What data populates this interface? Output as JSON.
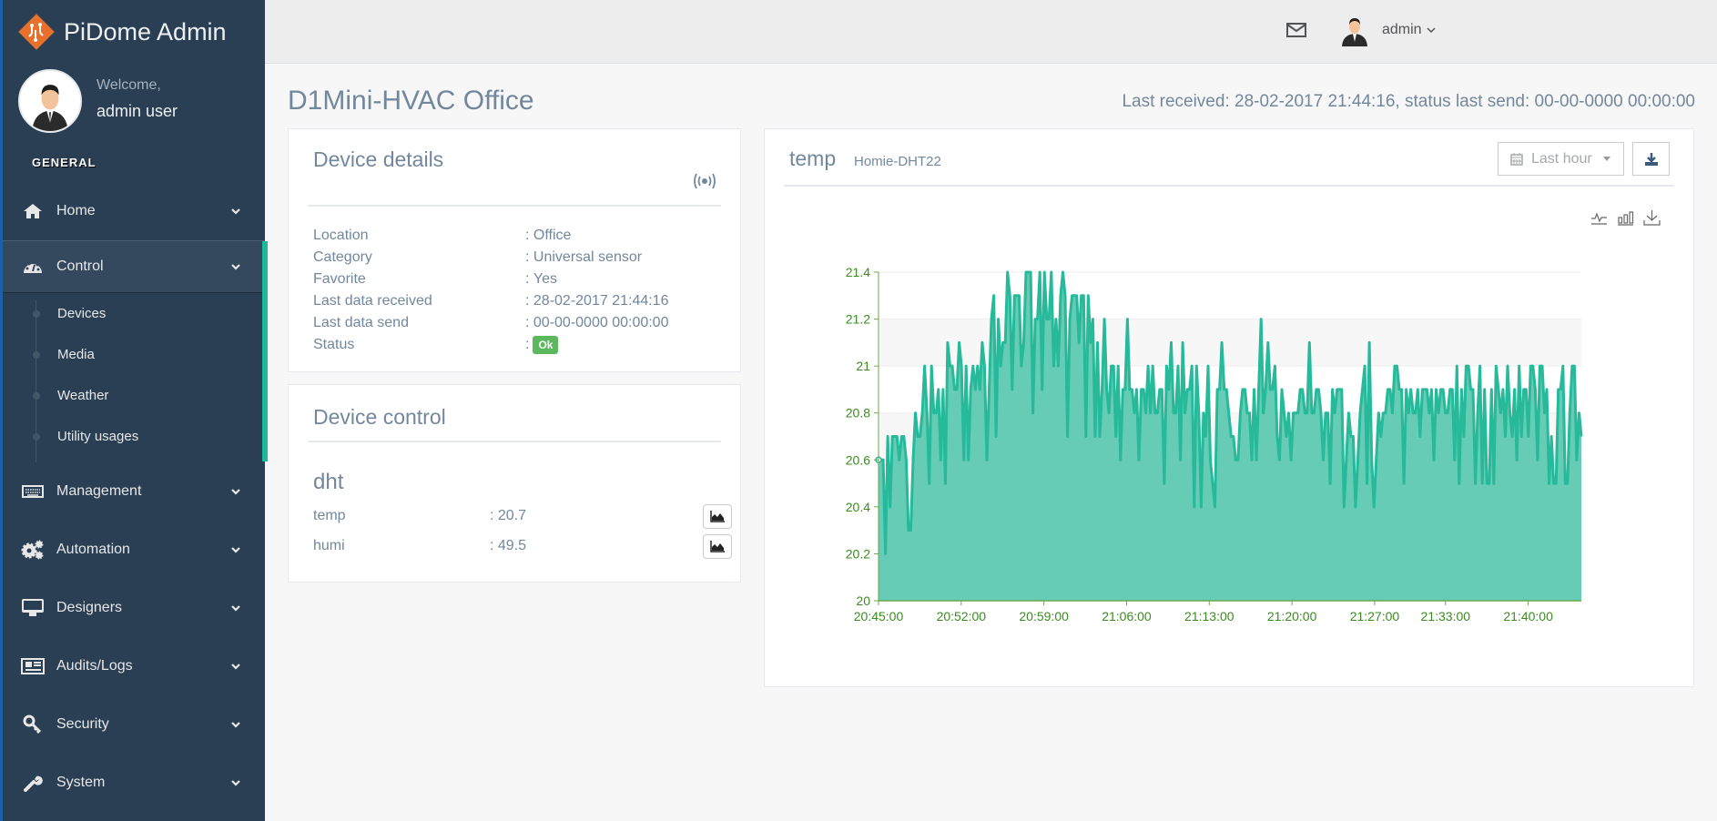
{
  "app": {
    "title": "PiDome Admin",
    "welcome": "Welcome,",
    "user_full": "admin user",
    "section": "GENERAL",
    "accent_color": "#1abb9c",
    "sidebar_color": "#2a3f54"
  },
  "nav": {
    "items": [
      {
        "label": "Home",
        "icon": "home-icon"
      },
      {
        "label": "Control",
        "icon": "dashboard-icon",
        "active": true
      },
      {
        "label": "Management",
        "icon": "keyboard-icon"
      },
      {
        "label": "Automation",
        "icon": "cogs-icon"
      },
      {
        "label": "Designers",
        "icon": "desktop-icon"
      },
      {
        "label": "Audits/Logs",
        "icon": "newspaper-icon"
      },
      {
        "label": "Security",
        "icon": "key-icon"
      },
      {
        "label": "System",
        "icon": "wrench-icon"
      }
    ],
    "control_sub": [
      {
        "label": "Devices"
      },
      {
        "label": "Media"
      },
      {
        "label": "Weather"
      },
      {
        "label": "Utility usages"
      }
    ]
  },
  "topbar": {
    "user": "admin",
    "mail_icon": "envelope-icon"
  },
  "page": {
    "title": "D1Mini-HVAC Office",
    "status": "Last received: 28-02-2017 21:44:16, status last send: 00-00-0000 00:00:00"
  },
  "details": {
    "title": "Device details",
    "rows": [
      {
        "label": "Location",
        "value": "Office"
      },
      {
        "label": "Category",
        "value": "Universal sensor"
      },
      {
        "label": "Favorite",
        "value": "Yes"
      },
      {
        "label": "Last data received",
        "value": "28-02-2017 21:44:16"
      },
      {
        "label": "Last data send",
        "value": "00-00-0000 00:00:00"
      },
      {
        "label": "Status",
        "value": "Ok"
      }
    ],
    "separator": ":",
    "status_color": "#5cb85c"
  },
  "control": {
    "title": "Device control",
    "group": "dht",
    "rows": [
      {
        "label": "temp",
        "value": "20.7"
      },
      {
        "label": "humi",
        "value": "49.5"
      }
    ]
  },
  "chartpanel": {
    "title": "temp",
    "subtitle": "Homie-DHT22",
    "range_label": "Last hour"
  },
  "chart_data": {
    "type": "area",
    "title": "temp",
    "subtitle": "Homie-DHT22",
    "xlabel": "",
    "ylabel": "",
    "ylim": [
      20,
      21.4
    ],
    "yticks": [
      "20",
      "20.2",
      "20.4",
      "20.6",
      "20.8",
      "21",
      "21.2",
      "21.4"
    ],
    "xticks": [
      "20:45:00",
      "20:52:00",
      "20:59:00",
      "21:06:00",
      "21:13:00",
      "21:20:00",
      "21:27:00",
      "21:33:00",
      "21:40:00"
    ],
    "x_range_minutes": [
      0,
      59.5
    ],
    "xtick_minutes": [
      0,
      7,
      14,
      21,
      28,
      35,
      42,
      48,
      55
    ],
    "grid": true,
    "line_color": "#26b99a",
    "fill_color": "#66ccb5",
    "series": [
      {
        "name": "temp",
        "values": [
          20.6,
          20.6,
          20.6,
          20.2,
          20.7,
          20.4,
          20.7,
          20.7,
          20.7,
          20.6,
          20.7,
          20.7,
          20.6,
          20.3,
          20.3,
          20.6,
          20.8,
          20.7,
          20.7,
          20.8,
          21.0,
          20.8,
          20.5,
          21.0,
          20.8,
          20.8,
          20.9,
          20.6,
          20.9,
          20.5,
          21.1,
          21.0,
          21.0,
          20.9,
          20.9,
          21.1,
          21.0,
          20.6,
          21.0,
          20.6,
          20.9,
          21.0,
          20.9,
          21.0,
          20.9,
          21.1,
          21.0,
          20.6,
          20.9,
          21.2,
          21.3,
          20.7,
          21.2,
          21.0,
          21.1,
          21.1,
          21.4,
          21.3,
          20.9,
          21.3,
          21.3,
          21.3,
          21.0,
          21.1,
          21.4,
          21.4,
          21.4,
          20.8,
          21.2,
          21.2,
          21.4,
          20.9,
          21.4,
          21.2,
          21.2,
          21.4,
          21.0,
          21.2,
          21.0,
          21.3,
          21.4,
          21.3,
          20.7,
          21.2,
          21.3,
          21.3,
          21.3,
          21.1,
          21.3,
          21.3,
          20.7,
          21.3,
          21.1,
          21.2,
          20.7,
          21.1,
          20.7,
          20.9,
          21.2,
          20.9,
          20.8,
          21.0,
          21.0,
          20.7,
          21.0,
          20.6,
          20.9,
          20.9,
          21.2,
          20.9,
          20.9,
          20.8,
          20.9,
          20.6,
          20.9,
          20.9,
          20.8,
          21.0,
          20.8,
          21.0,
          20.8,
          20.8,
          20.9,
          20.9,
          20.5,
          21.0,
          20.9,
          21.1,
          20.8,
          20.8,
          21.0,
          20.6,
          21.1,
          20.8,
          20.9,
          20.9,
          21.0,
          20.4,
          21.0,
          20.8,
          20.4,
          20.8,
          20.7,
          21.0,
          20.6,
          20.5,
          20.4,
          20.9,
          20.9,
          21.1,
          20.9,
          20.9,
          20.8,
          20.7,
          20.7,
          20.6,
          20.6,
          20.8,
          20.9,
          20.9,
          20.8,
          20.8,
          20.6,
          20.9,
          20.6,
          20.9,
          21.2,
          20.8,
          20.9,
          21.1,
          20.9,
          20.9,
          21.0,
          20.7,
          20.6,
          20.9,
          20.8,
          20.7,
          20.8,
          20.6,
          20.8,
          20.8,
          20.8,
          20.9,
          20.9,
          20.8,
          20.8,
          21.1,
          20.8,
          20.8,
          20.9,
          20.9,
          20.8,
          20.6,
          20.8,
          20.8,
          20.5,
          20.9,
          20.8,
          20.9,
          20.9,
          20.9,
          20.4,
          20.6,
          20.8,
          20.7,
          20.7,
          20.4,
          20.6,
          20.8,
          20.9,
          21.0,
          20.5,
          21.1,
          20.6,
          20.4,
          20.6,
          20.8,
          20.7,
          20.8,
          20.8,
          20.9,
          20.9,
          20.8,
          21.0,
          21.0,
          20.9,
          20.9,
          20.5,
          20.9,
          20.8,
          20.9,
          20.8,
          20.8,
          20.9,
          20.7,
          20.9,
          20.9,
          20.9,
          20.8,
          20.9,
          20.6,
          20.9,
          20.8,
          20.9,
          20.9,
          20.8,
          20.8,
          20.9,
          20.9,
          20.6,
          21.0,
          20.5,
          20.9,
          20.7,
          21.0,
          21.0,
          20.9,
          20.9,
          20.5,
          20.8,
          21.0,
          20.5,
          20.9,
          20.5,
          20.5,
          20.9,
          20.5,
          21.0,
          20.9,
          20.8,
          20.9,
          20.7,
          21.0,
          20.8,
          20.7,
          20.9,
          20.6,
          21.0,
          20.7,
          20.9,
          20.9,
          20.7,
          21.0,
          21.0,
          20.9,
          20.6,
          21.0,
          21.0,
          20.8,
          20.9,
          20.5,
          20.7,
          20.5,
          20.5,
          20.9,
          20.9,
          21.0,
          20.5,
          20.5,
          20.8,
          21.0,
          21.0,
          20.6,
          20.8,
          20.7
        ]
      }
    ]
  }
}
